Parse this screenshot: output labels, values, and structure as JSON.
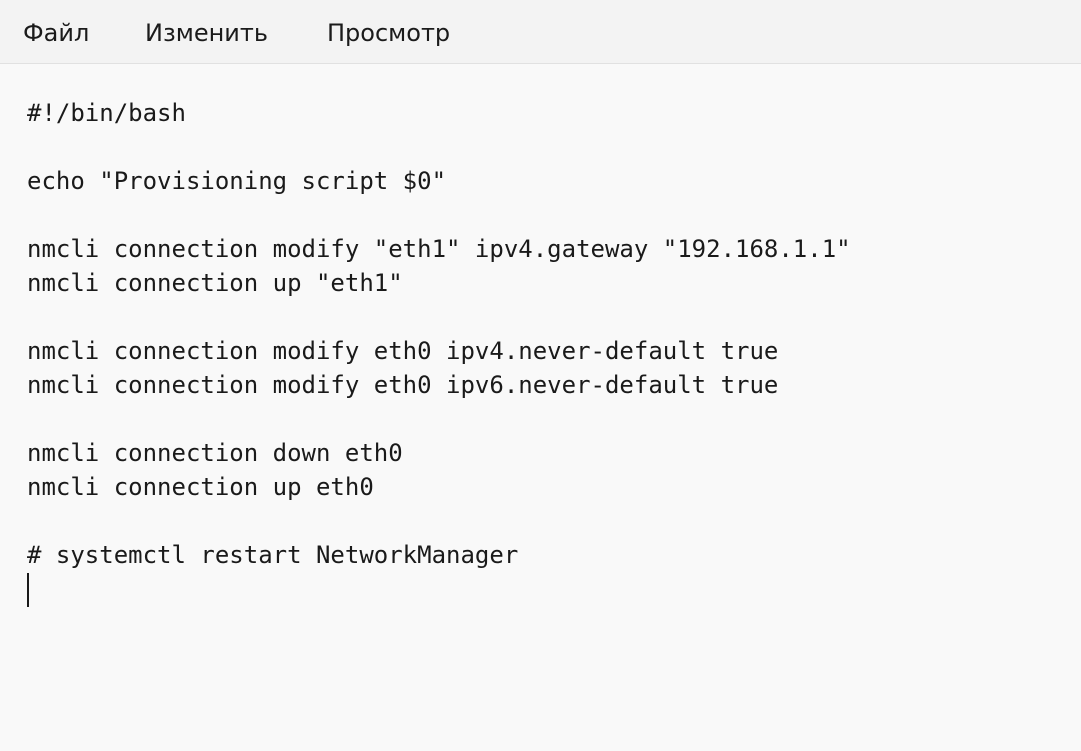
{
  "menu": {
    "items": [
      {
        "label": "Файл"
      },
      {
        "label": "Изменить"
      },
      {
        "label": "Просмотр"
      }
    ]
  },
  "editor": {
    "lines": [
      "#!/bin/bash",
      "",
      "echo \"Provisioning script $0\"",
      "",
      "nmcli connection modify \"eth1\" ipv4.gateway \"192.168.1.1\"",
      "nmcli connection up \"eth1\"",
      "",
      "nmcli connection modify eth0 ipv4.never-default true",
      "nmcli connection modify eth0 ipv6.never-default true",
      "",
      "nmcli connection down eth0",
      "nmcli connection up eth0",
      "",
      "# systemctl restart NetworkManager"
    ]
  }
}
